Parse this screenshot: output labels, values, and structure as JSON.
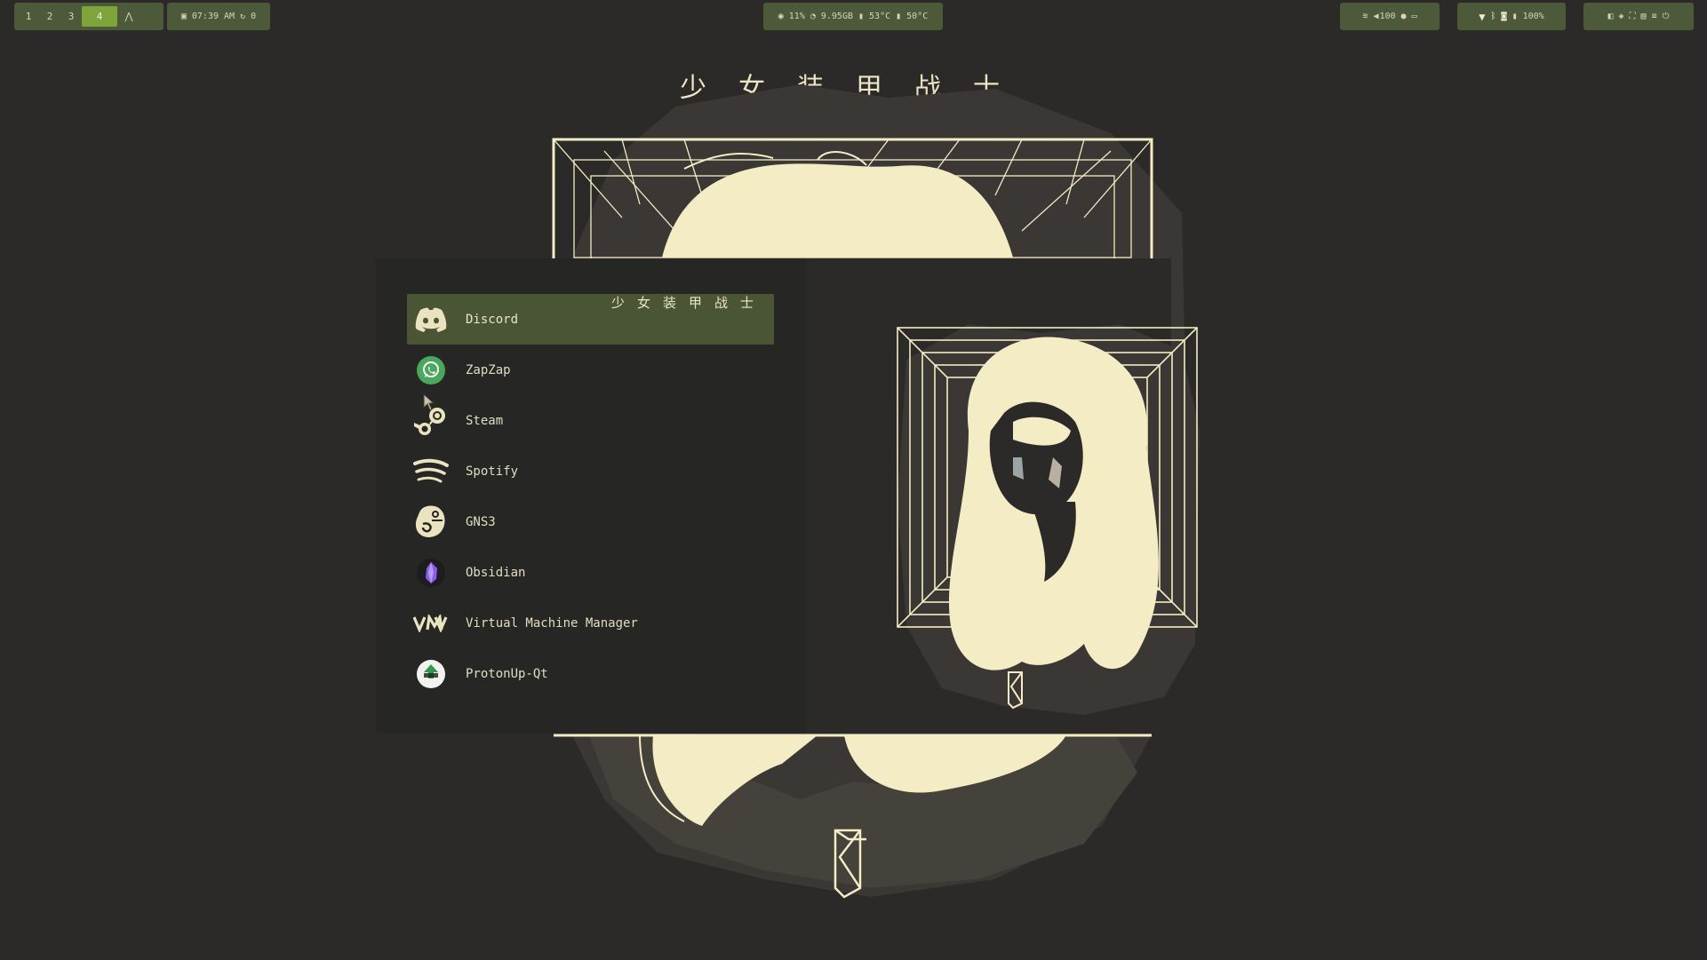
{
  "topbar": {
    "workspaces": [
      "1",
      "2",
      "3",
      "4"
    ],
    "active_workspace": "4",
    "launcher_glyph": "⋀",
    "clock": "07:39 AM",
    "updates_count": "0",
    "cpu": "11%",
    "memory": "9.95GB",
    "cpu_temp": "53°C",
    "gpu_temp": "50°C",
    "volume": "100",
    "battery": "100%"
  },
  "wallpaper": {
    "title": "少女装甲战士"
  },
  "launcher": {
    "items": [
      {
        "label": "Discord",
        "icon": "discord-icon",
        "selected": true
      },
      {
        "label": "ZapZap",
        "icon": "whatsapp-icon",
        "selected": false
      },
      {
        "label": "Steam",
        "icon": "steam-icon",
        "selected": false
      },
      {
        "label": "Spotify",
        "icon": "spotify-icon",
        "selected": false
      },
      {
        "label": "GNS3",
        "icon": "gns3-icon",
        "selected": false
      },
      {
        "label": "Obsidian",
        "icon": "obsidian-icon",
        "selected": false
      },
      {
        "label": "Virtual Machine Manager",
        "icon": "virt-manager-icon",
        "selected": false
      },
      {
        "label": "ProtonUp-Qt",
        "icon": "protonup-icon",
        "selected": false
      }
    ],
    "preview_title": "少女装甲战士"
  },
  "colors": {
    "background": "#2b2a28",
    "bar_pill": "#4c5a3a",
    "active_workspace": "#7da53b",
    "selection": "#4a5536",
    "cream": "#f4ecc4"
  }
}
